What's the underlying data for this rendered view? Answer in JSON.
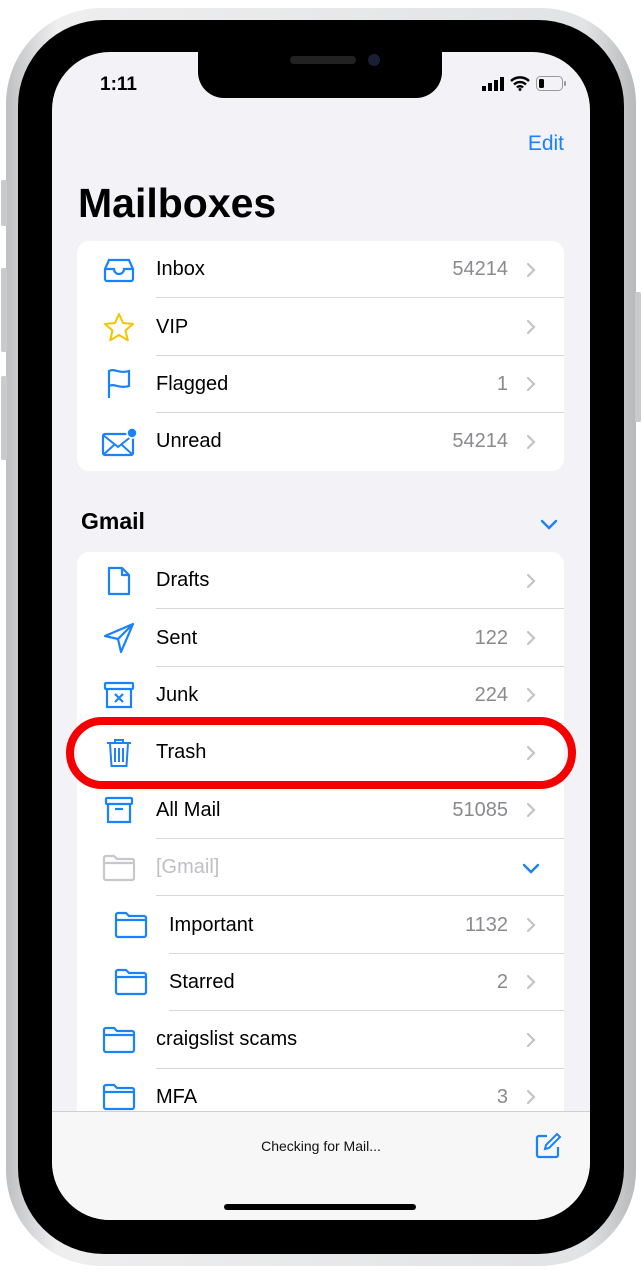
{
  "status_bar": {
    "time": "1:11"
  },
  "nav": {
    "edit_label": "Edit",
    "title": "Mailboxes"
  },
  "smart_mailboxes": [
    {
      "label": "Inbox",
      "count": "54214",
      "icon": "inbox-tray-icon"
    },
    {
      "label": "VIP",
      "count": "",
      "icon": "star-icon"
    },
    {
      "label": "Flagged",
      "count": "1",
      "icon": "flag-icon"
    },
    {
      "label": "Unread",
      "count": "54214",
      "icon": "envelope-unread-icon"
    }
  ],
  "gmail": {
    "header": "Gmail",
    "items": [
      {
        "label": "Drafts",
        "count": "",
        "icon": "document-icon"
      },
      {
        "label": "Sent",
        "count": "122",
        "icon": "paper-plane-icon"
      },
      {
        "label": "Junk",
        "count": "224",
        "icon": "junk-bin-icon"
      },
      {
        "label": "Trash",
        "count": "",
        "icon": "trash-icon"
      },
      {
        "label": "All Mail",
        "count": "51085",
        "icon": "archive-box-icon"
      },
      {
        "label": "[Gmail]",
        "count": "",
        "icon": "folder-icon"
      },
      {
        "label": "Important",
        "count": "1132",
        "icon": "folder-icon"
      },
      {
        "label": "Starred",
        "count": "2",
        "icon": "folder-icon"
      },
      {
        "label": "craigslist scams",
        "count": "",
        "icon": "folder-icon"
      },
      {
        "label": "MFA",
        "count": "3",
        "icon": "folder-icon"
      }
    ]
  },
  "toolbar": {
    "status": "Checking for Mail...",
    "compose_icon": "compose-icon"
  },
  "colors": {
    "accent": "#1a82fb",
    "highlight": "#f40000",
    "vip_star": "#f5c400"
  }
}
